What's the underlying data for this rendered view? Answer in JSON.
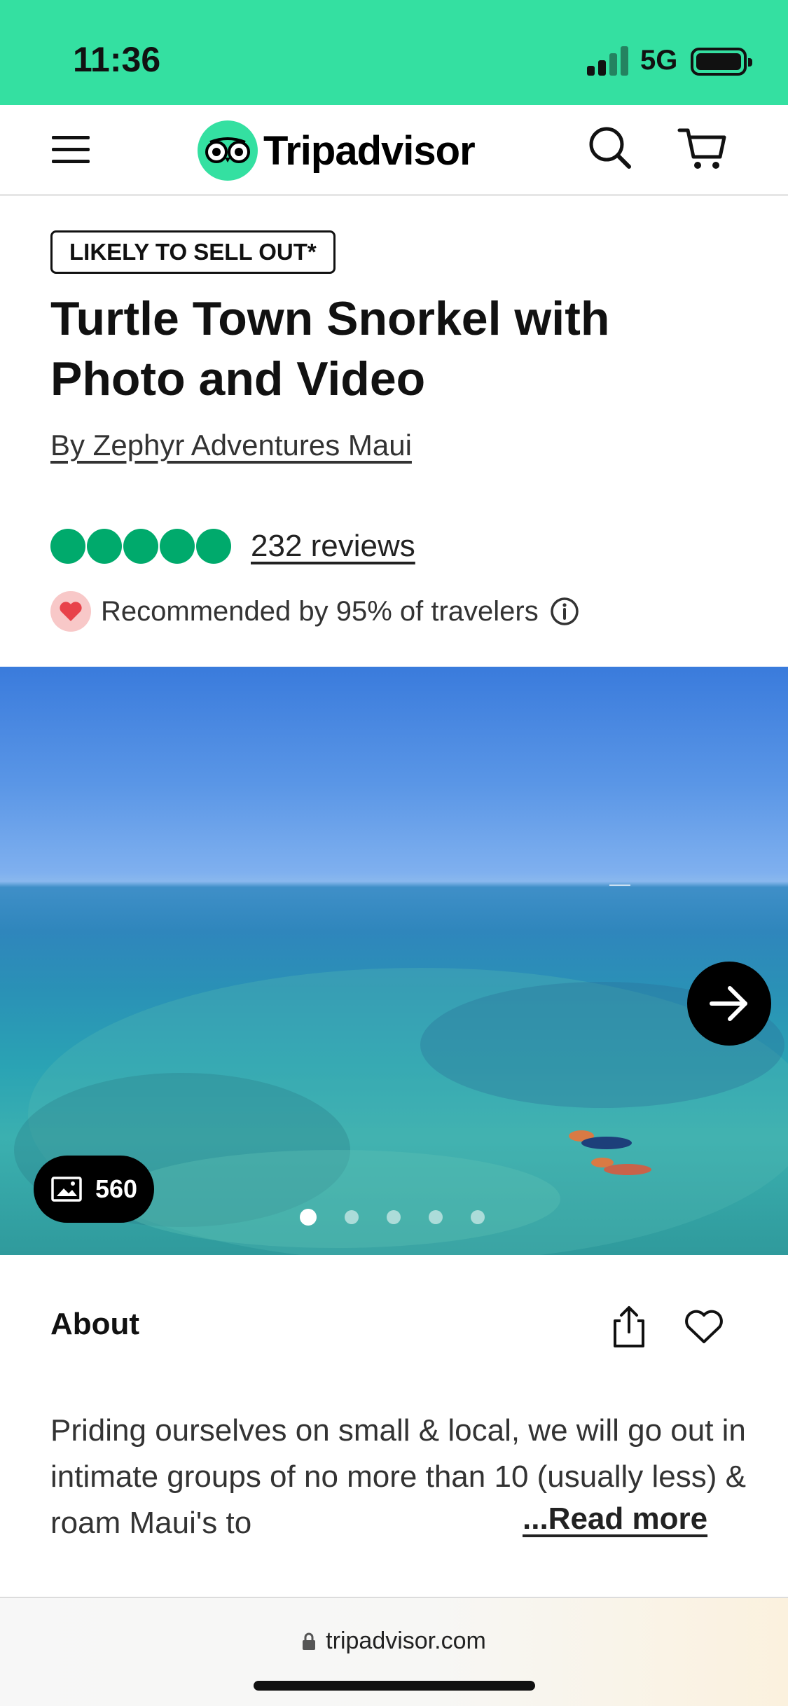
{
  "status_bar": {
    "time": "11:36",
    "network": "5G",
    "background_color": "#34e0a1"
  },
  "nav": {
    "logo_text": "Tripadvisor",
    "menu_icon": "hamburger-menu-icon",
    "search_icon": "search-icon",
    "cart_icon": "cart-icon"
  },
  "listing": {
    "badge": "LIKELY TO SELL OUT*",
    "title": "Turtle Town Snorkel with Photo and Video",
    "operator": "By Zephyr Adventures Maui",
    "rating_bubbles": 5,
    "rating_color": "#00aa6c",
    "reviews_link": "232 reviews",
    "recommendation": "Recommended by 95% of travelers"
  },
  "gallery": {
    "photo_count": "560",
    "slides_total": 5,
    "active_slide": 1,
    "next_icon": "arrow-right-icon"
  },
  "about": {
    "heading": "About",
    "text": "Priding ourselves on small & local, we will go out in intimate groups of no more than 10 (usually less) & roam Maui's to",
    "read_more": "...Read more",
    "share_icon": "share-icon",
    "save_icon": "heart-icon"
  },
  "browser": {
    "url": "tripadvisor.com"
  }
}
